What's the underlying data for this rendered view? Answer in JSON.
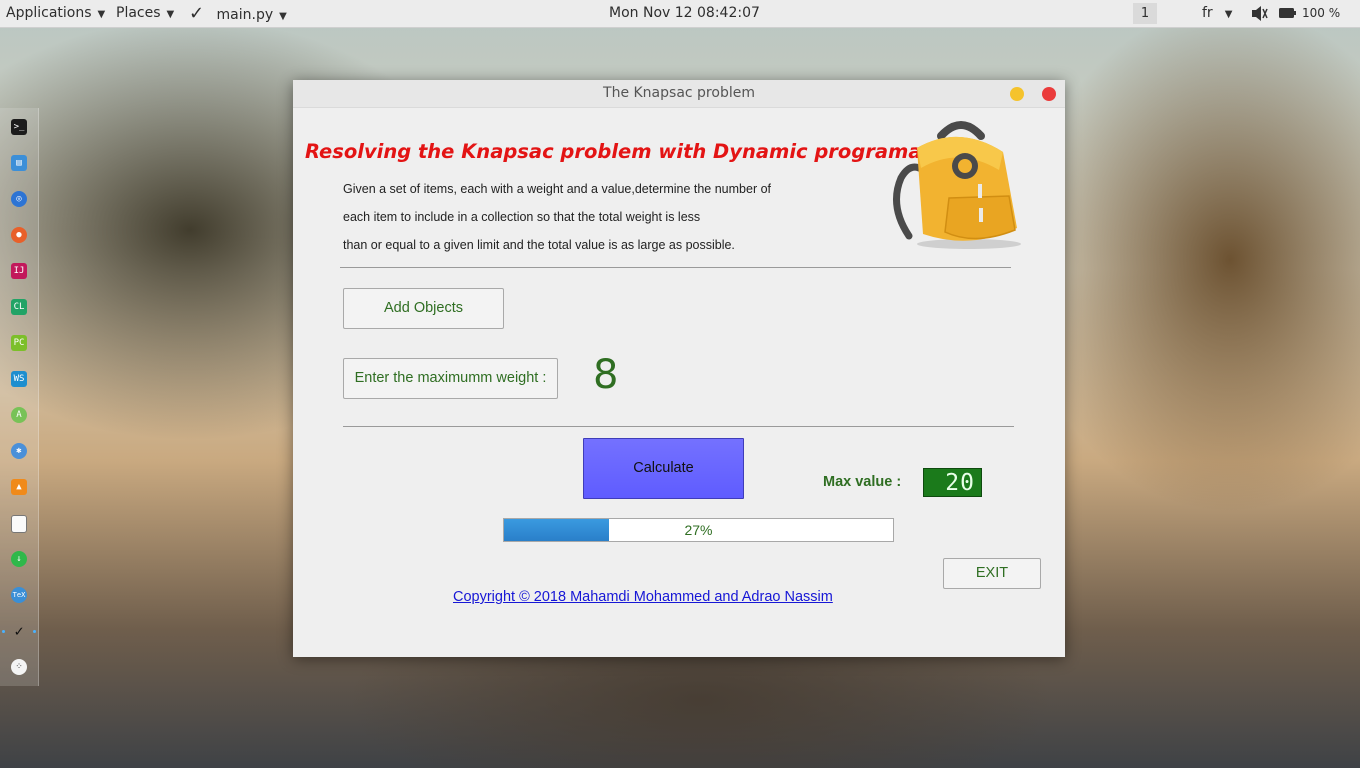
{
  "topbar": {
    "applications": "Applications",
    "places": "Places",
    "active_app": "main.py",
    "clock": "Mon Nov 12  08:42:07",
    "workspace": "1",
    "keyboard_layout": "fr",
    "battery": "100 %"
  },
  "window": {
    "title": "The Knapsac problem",
    "heading": "Resolving the Knapsac problem with Dynamic programation",
    "description": [
      "Given a set of items, each with a weight and a value,determine the number of",
      "each item to include in a collection so that the total weight is less",
      "than or equal to a given limit and the total value is as large as possible."
    ],
    "add_objects_label": "Add Objects",
    "max_weight_label": "Enter the maximumm weight :",
    "max_weight_value": "8",
    "calculate_label": "Calculate",
    "max_value_label": "Max value :",
    "max_value": "20",
    "progress_percent": 27,
    "progress_text": "27%",
    "exit_label": "EXIT",
    "copyright": "Copyright © 2018 Mahamdi Mohammed and Adrao Nassim"
  },
  "colors": {
    "heading": "#e31414",
    "label_green": "#2f6e22",
    "calculate_bg": "#6462ff",
    "lcd_bg": "#1b7a1b",
    "progress_fill": "#2f88d2",
    "link": "#1717d6"
  },
  "dock_icons": [
    "terminal-icon",
    "files-icon",
    "browser-icon",
    "firefox-icon",
    "intellij-icon",
    "clion-icon",
    "pycharm-icon",
    "webstorm-icon",
    "android-studio-icon",
    "settings-icon",
    "vlc-icon",
    "document-icon",
    "downloads-icon",
    "tex-icon",
    "check-icon",
    "apps-grid-icon"
  ]
}
